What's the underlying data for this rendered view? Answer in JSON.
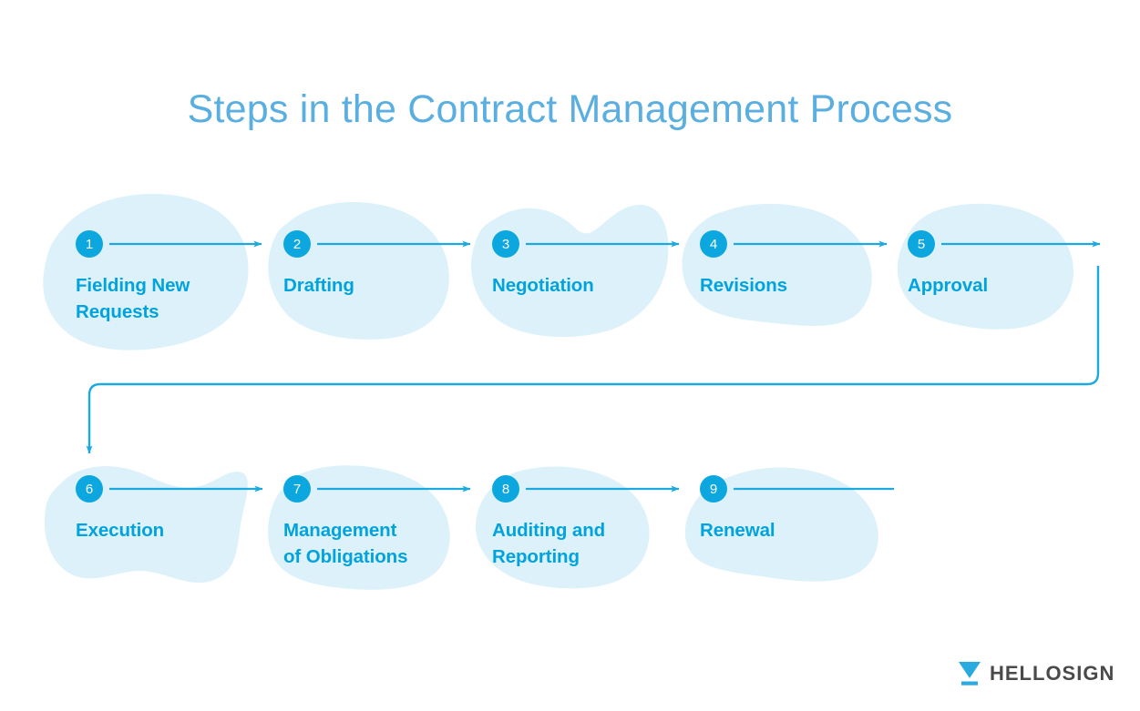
{
  "title": "Steps in the Contract Management Process",
  "colors": {
    "accent": "#0DA7E0",
    "label": "#00A3DE",
    "title": "#5BAFE0",
    "blob": "#DCF1FA",
    "logo_mark": "#29ABE2",
    "logo_text": "#4A4A4A",
    "background": "#FFFFFF"
  },
  "steps": [
    {
      "number": "1",
      "label": "Fielding New\nRequests",
      "row": 1
    },
    {
      "number": "2",
      "label": "Drafting",
      "row": 1
    },
    {
      "number": "3",
      "label": "Negotiation",
      "row": 1
    },
    {
      "number": "4",
      "label": "Revisions",
      "row": 1
    },
    {
      "number": "5",
      "label": "Approval",
      "row": 1
    },
    {
      "number": "6",
      "label": "Execution",
      "row": 2
    },
    {
      "number": "7",
      "label": "Management\nof Obligations",
      "row": 2
    },
    {
      "number": "8",
      "label": "Auditing and\nReporting",
      "row": 2
    },
    {
      "number": "9",
      "label": "Renewal",
      "row": 2
    }
  ],
  "logo": {
    "mark": "funnel-icon",
    "text": "HELLOSIGN"
  }
}
